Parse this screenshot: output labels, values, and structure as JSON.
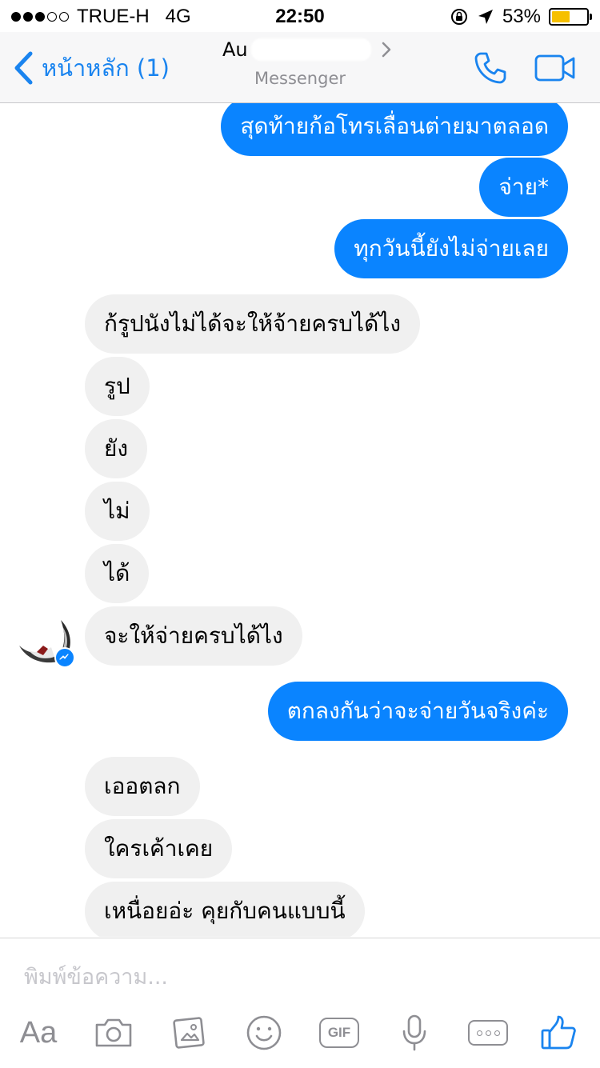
{
  "status_bar": {
    "carrier": "TRUE-H",
    "network": "4G",
    "time": "22:50",
    "battery_percent": "53%",
    "battery_level": 0.53,
    "signal_bars": 3,
    "signal_max": 5,
    "battery_color": "#f6c000"
  },
  "header": {
    "back_label": "หน้าหลัก (1)",
    "contact_name_partial": "Au",
    "subtitle": "Messenger",
    "accent_color": "#1a84ef",
    "icons": [
      "chevron-left-icon",
      "chevron-right-icon",
      "phone-icon",
      "video-icon"
    ]
  },
  "messages": [
    {
      "from": "me",
      "text": "สุดท้ายก้อโทรเลื่อนต่ายมาตลอด"
    },
    {
      "from": "me",
      "text": "จ่าย*"
    },
    {
      "from": "me",
      "text": "ทุกวันนี้ยังไม่จ่ายเลย"
    },
    {
      "from": "them",
      "text": "ก้รูปนังไม่ได้จะให้จ้ายครบได้ไง"
    },
    {
      "from": "them",
      "text": "รูป"
    },
    {
      "from": "them",
      "text": "ยัง"
    },
    {
      "from": "them",
      "text": "ไม่"
    },
    {
      "from": "them",
      "text": "ได้"
    },
    {
      "from": "them",
      "text": "จะให้จ่ายครบได้ไง"
    },
    {
      "from": "me",
      "text": "ตกลงกันว่าจะจ่ายวันจริงค่ะ"
    },
    {
      "from": "them",
      "text": "เออตลก"
    },
    {
      "from": "them",
      "text": "ใครเค้าเคย"
    },
    {
      "from": "them",
      "text": "เหนื่อยอ่ะ คุยกับคนแบบนี้"
    }
  ],
  "colors": {
    "outgoing_bubble": "#0a84ff",
    "incoming_bubble": "#f0f0f0"
  },
  "composer": {
    "placeholder": "พิมพ์ข้อความ...",
    "aa_label": "Aa",
    "gif_label": "GIF",
    "toolbar_icons": [
      "text-format-icon",
      "camera-icon",
      "photo-icon",
      "emoji-icon",
      "gif-icon",
      "microphone-icon",
      "more-icon",
      "thumbs-up-icon"
    ]
  }
}
